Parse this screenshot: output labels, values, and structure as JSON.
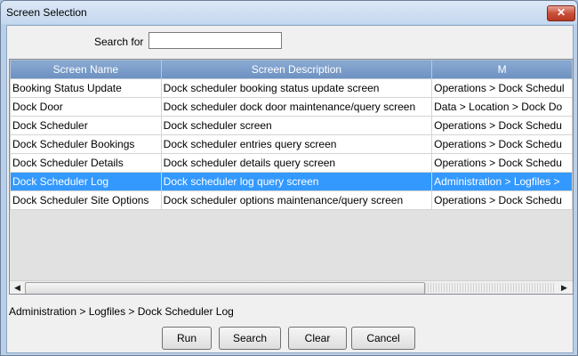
{
  "window": {
    "title": "Screen Selection",
    "close_glyph": "✕"
  },
  "search": {
    "label": "Search for",
    "value": ""
  },
  "table": {
    "columns": [
      "Screen Name",
      "Screen Description",
      "M"
    ],
    "rows": [
      [
        "Booking Status Update",
        "Dock scheduler booking status update screen",
        "Operations > Dock Schedul"
      ],
      [
        "Dock Door",
        "Dock scheduler dock door maintenance/query screen",
        "Data > Location > Dock Do"
      ],
      [
        "Dock Scheduler",
        "Dock scheduler screen",
        "Operations > Dock Schedu"
      ],
      [
        "Dock Scheduler Bookings",
        "Dock scheduler entries query screen",
        "Operations > Dock Schedu"
      ],
      [
        "Dock Scheduler Details",
        "Dock scheduler details query screen",
        "Operations > Dock Schedu"
      ],
      [
        "Dock Scheduler Log",
        "Dock scheduler log query screen",
        "Administration > Logfiles >"
      ],
      [
        "Dock Scheduler Site Options",
        "Dock scheduler options maintenance/query screen",
        "Operations > Dock Schedu"
      ]
    ],
    "selected_row_index": 5
  },
  "scrollbar": {
    "left_glyph": "◀",
    "right_glyph": "▶"
  },
  "selected_path": "Administration > Logfiles > Dock Scheduler Log",
  "buttons": {
    "run": "Run",
    "search": "Search",
    "clear": "Clear",
    "cancel": "Cancel"
  },
  "colors": {
    "selection": "#3399ff",
    "header": "#7b9bc9",
    "close": "#c9503a"
  }
}
